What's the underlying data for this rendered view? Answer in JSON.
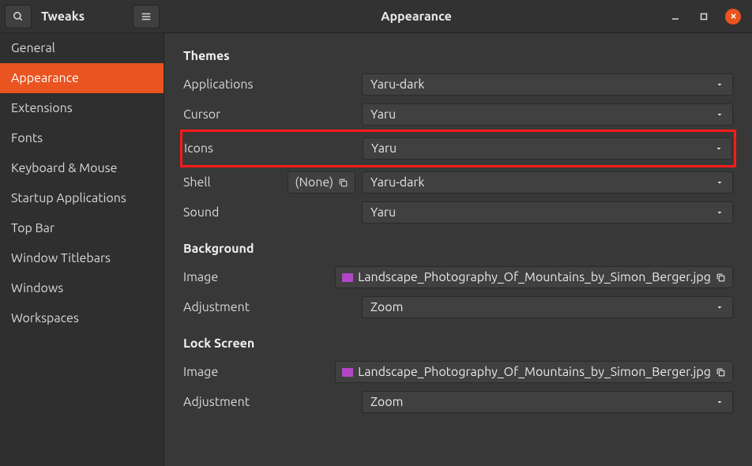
{
  "app_title": "Tweaks",
  "page_title": "Appearance",
  "sidebar": {
    "items": [
      {
        "label": "General"
      },
      {
        "label": "Appearance"
      },
      {
        "label": "Extensions"
      },
      {
        "label": "Fonts"
      },
      {
        "label": "Keyboard & Mouse"
      },
      {
        "label": "Startup Applications"
      },
      {
        "label": "Top Bar"
      },
      {
        "label": "Window Titlebars"
      },
      {
        "label": "Windows"
      },
      {
        "label": "Workspaces"
      }
    ],
    "active_index": 1
  },
  "sections": {
    "themes": {
      "title": "Themes",
      "applications_label": "Applications",
      "applications_value": "Yaru-dark",
      "cursor_label": "Cursor",
      "cursor_value": "Yaru",
      "icons_label": "Icons",
      "icons_value": "Yaru",
      "shell_label": "Shell",
      "shell_none": "(None)",
      "shell_value": "Yaru-dark",
      "sound_label": "Sound",
      "sound_value": "Yaru"
    },
    "background": {
      "title": "Background",
      "image_label": "Image",
      "image_value": "Landscape_Photography_Of_Mountains_by_Simon_Berger.jpg",
      "adjustment_label": "Adjustment",
      "adjustment_value": "Zoom"
    },
    "lockscreen": {
      "title": "Lock Screen",
      "image_label": "Image",
      "image_value": "Landscape_Photography_Of_Mountains_by_Simon_Berger.jpg",
      "adjustment_label": "Adjustment",
      "adjustment_value": "Zoom"
    }
  }
}
